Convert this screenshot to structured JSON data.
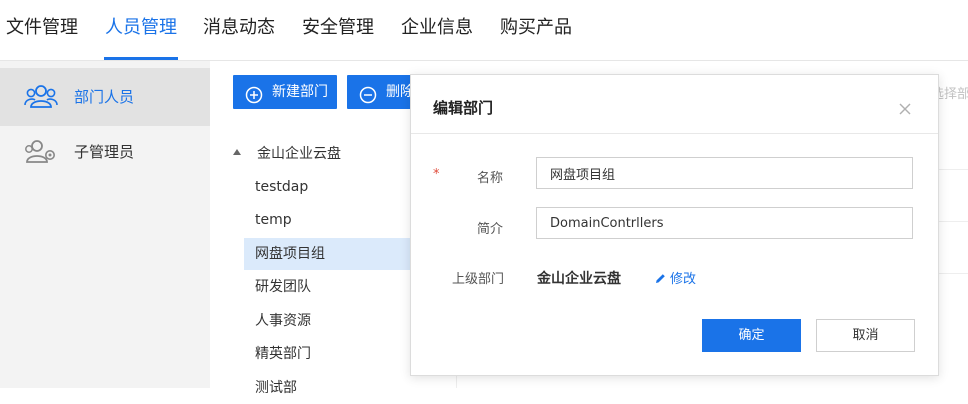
{
  "topnav": {
    "tabs": [
      {
        "label": "文件管理"
      },
      {
        "label": "人员管理",
        "active": true
      },
      {
        "label": "消息动态"
      },
      {
        "label": "安全管理"
      },
      {
        "label": "企业信息"
      },
      {
        "label": "购买产品"
      }
    ]
  },
  "sidebar": {
    "items": [
      {
        "label": "部门人员",
        "icon": "users-group-icon",
        "active": true
      },
      {
        "label": "子管理员",
        "icon": "sub-admin-icon"
      }
    ]
  },
  "toolbar": {
    "new_department_label": "新建部门",
    "delete_label": "删除",
    "search_hint": "选择部门"
  },
  "tree": {
    "root": "金山企业云盘",
    "items": [
      {
        "label": "testdap"
      },
      {
        "label": "temp"
      },
      {
        "label": "网盘项目组",
        "selected": true
      },
      {
        "label": "研发团队"
      },
      {
        "label": "人事资源"
      },
      {
        "label": "精英部门"
      },
      {
        "label": "测试部"
      }
    ]
  },
  "modal": {
    "title": "编辑部门",
    "required_mark": "*",
    "name_label": "名称",
    "name_value": "网盘项目组",
    "desc_label": "简介",
    "desc_value": "DomainContrllers",
    "parent_label": "上级部门",
    "parent_value": "金山企业云盘",
    "modify_label": "修改",
    "ok_label": "确定",
    "cancel_label": "取消"
  },
  "colors": {
    "accent": "#1a73e8",
    "selected_bg": "#dbeafb",
    "sidebar_bg": "#f3f3f3",
    "required": "#e04b3a"
  }
}
